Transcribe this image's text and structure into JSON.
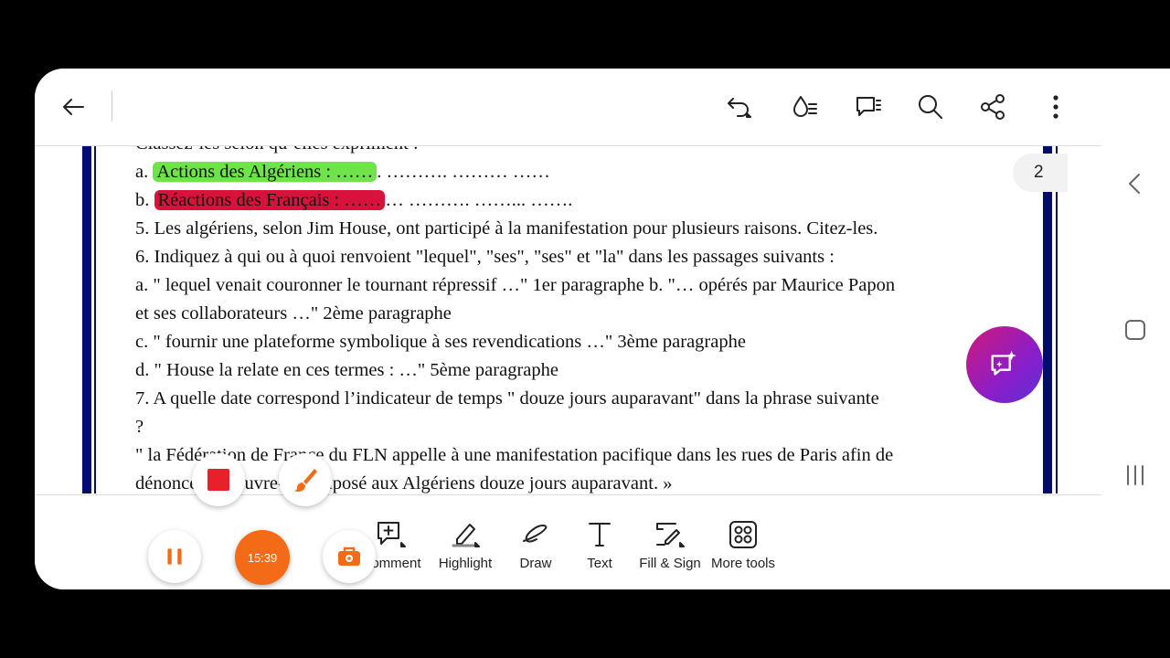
{
  "topbar": {
    "icons": [
      "back-arrow-icon",
      "undo-icon",
      "reading-mode-icon",
      "comment-list-icon",
      "search-icon",
      "share-icon",
      "more-vertical-icon"
    ]
  },
  "document": {
    "lines": [
      {
        "segments": [
          {
            "text": "Classez-les selon qu’elles expriment :",
            "hl": ""
          }
        ]
      },
      {
        "segments": [
          {
            "text": "a. ",
            "hl": ""
          },
          {
            "text": "Actions des Algériens : ……",
            "hl": "green"
          },
          {
            "text": ". ………. ……… ……",
            "hl": ""
          }
        ]
      },
      {
        "segments": [
          {
            "text": "b. ",
            "hl": ""
          },
          {
            "text": "Réactions des Français : ……",
            "hl": "red"
          },
          {
            "text": "… ………. ……... …….",
            "hl": ""
          }
        ]
      },
      {
        "segments": [
          {
            "text": "5. Les algériens, selon Jim House, ont participé à la manifestation pour plusieurs raisons. Citez-les.",
            "hl": ""
          }
        ]
      },
      {
        "segments": [
          {
            "text": "6. Indiquez à qui ou à quoi renvoient \"lequel\", \"ses\", \"ses\" et \"la\" dans les passages suivants :",
            "hl": ""
          }
        ]
      },
      {
        "segments": [
          {
            "text": "a. \" lequel venait couronner le tournant répressif …\" 1er paragraphe b. \"… opérés par Maurice Papon",
            "hl": ""
          }
        ]
      },
      {
        "segments": [
          {
            "text": "et ses collaborateurs …\" 2ème paragraphe",
            "hl": ""
          }
        ]
      },
      {
        "segments": [
          {
            "text": "c. \" fournir une plateforme symbolique à ses revendications …\" 3ème paragraphe",
            "hl": ""
          }
        ]
      },
      {
        "segments": [
          {
            "text": "d. \" House la relate en ces termes : …\" 5ème paragraphe",
            "hl": ""
          }
        ]
      },
      {
        "segments": [
          {
            "text": "7. A quelle date correspond l’indicateur de temps \" douze jours auparavant\" dans la phrase suivante",
            "hl": ""
          }
        ]
      },
      {
        "segments": [
          {
            "text": "?",
            "hl": ""
          }
        ]
      },
      {
        "segments": [
          {
            "text": "\" la Fédération de France du FLN appelle à une manifestation pacifique dans les rues de Paris afin de",
            "hl": ""
          }
        ]
      },
      {
        "segments": [
          {
            "text": "dénoncer le couvre-feu imposé aux Algériens douze jours auparavant. »",
            "hl": ""
          }
        ]
      }
    ]
  },
  "tools": [
    {
      "label": "Comment",
      "icon": "add-comment-icon"
    },
    {
      "label": "Highlight",
      "icon": "highlighter-icon"
    },
    {
      "label": "Draw",
      "icon": "draw-icon"
    },
    {
      "label": "Text",
      "icon": "text-icon"
    },
    {
      "label": "Fill & Sign",
      "icon": "fill-sign-icon"
    },
    {
      "label": "More tools",
      "icon": "more-tools-icon"
    }
  ],
  "recorder": {
    "timer": "15:39",
    "pause_icon": "pause-icon",
    "stop_icon": "stop-icon",
    "brush_icon": "brush-icon",
    "toolbox_icon": "toolbox-icon",
    "colors": {
      "accent": "#f36b16",
      "stop": "#e8202a"
    }
  },
  "page_badge": "2",
  "colors": {
    "green_highlight": "#6ee34a",
    "red_highlight": "#d8123a",
    "border": "#000c6e"
  }
}
